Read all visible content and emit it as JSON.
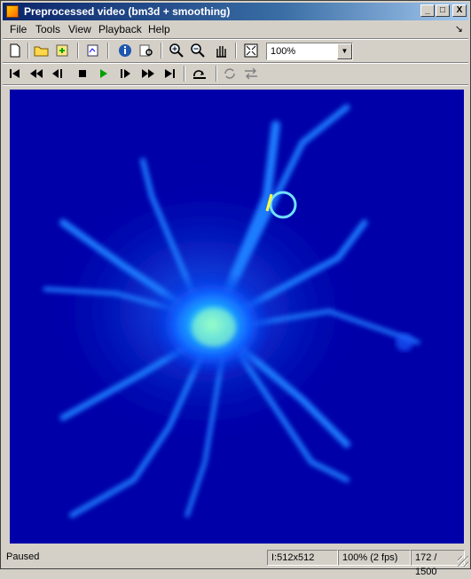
{
  "window": {
    "title": "Preprocessed video (bm3d + smoothing)"
  },
  "window_controls": {
    "minimize": "_",
    "maximize": "□",
    "close": "X"
  },
  "menu": {
    "items": [
      "File",
      "Tools",
      "View",
      "Playback",
      "Help"
    ],
    "undock": "↘"
  },
  "toolbar": {
    "zoom_value": "100%",
    "icons": [
      "new-file-icon",
      "open-folder-icon",
      "export-icon",
      "print-to-figure-icon",
      "info-icon",
      "pixel-region-icon",
      "zoom-in-icon",
      "zoom-out-icon",
      "pan-hand-icon",
      "fit-to-window-icon"
    ]
  },
  "playback": {
    "icons": [
      "go-to-first-icon",
      "rewind-icon",
      "step-back-icon",
      "stop-icon",
      "play-icon",
      "step-forward-icon",
      "fast-forward-icon",
      "go-to-last-icon",
      "jump-to-icon",
      "repeat-icon",
      "forward-backward-icon"
    ]
  },
  "colors": {
    "background": "#0000a8",
    "title_start": "#0a246a",
    "title_end": "#a6caf0",
    "play": "#00a000"
  },
  "status": {
    "state": "Paused",
    "size": "I:512x512",
    "zoom_fps": "100% (2 fps)",
    "frame": "172 / 1500"
  }
}
